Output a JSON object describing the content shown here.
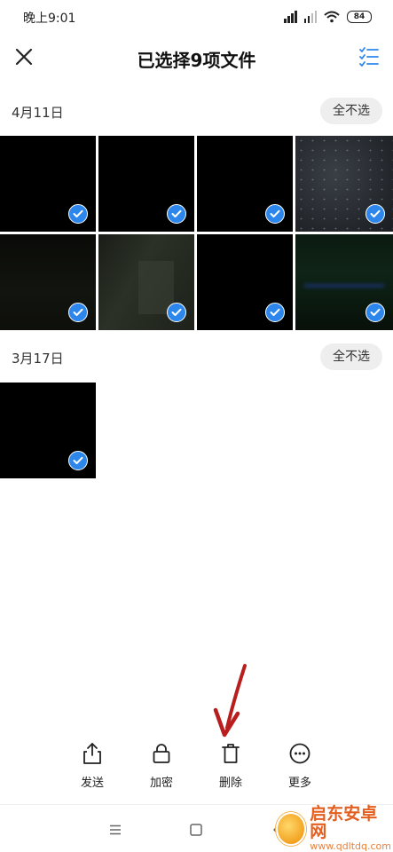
{
  "status_bar": {
    "time": "晚上9:01",
    "battery": "84"
  },
  "header": {
    "title": "已选择9项文件"
  },
  "groups": [
    {
      "date": "4月11日",
      "deselect_label": "全不选"
    },
    {
      "date": "3月17日",
      "deselect_label": "全不选"
    }
  ],
  "action_bar": {
    "items": [
      {
        "label": "发送",
        "icon": "share-icon"
      },
      {
        "label": "加密",
        "icon": "lock-icon"
      },
      {
        "label": "删除",
        "icon": "trash-icon"
      },
      {
        "label": "更多",
        "icon": "more-icon"
      }
    ]
  },
  "nav_bar": {
    "items": [
      "menu-icon",
      "home-icon",
      "back-icon"
    ]
  },
  "watermark": {
    "name": "启东安卓网",
    "url": "www.qdltdq.com"
  },
  "colors": {
    "accent": "#2d86ec",
    "arrow": "#b81e1e",
    "chip_bg": "#eeeeee"
  }
}
